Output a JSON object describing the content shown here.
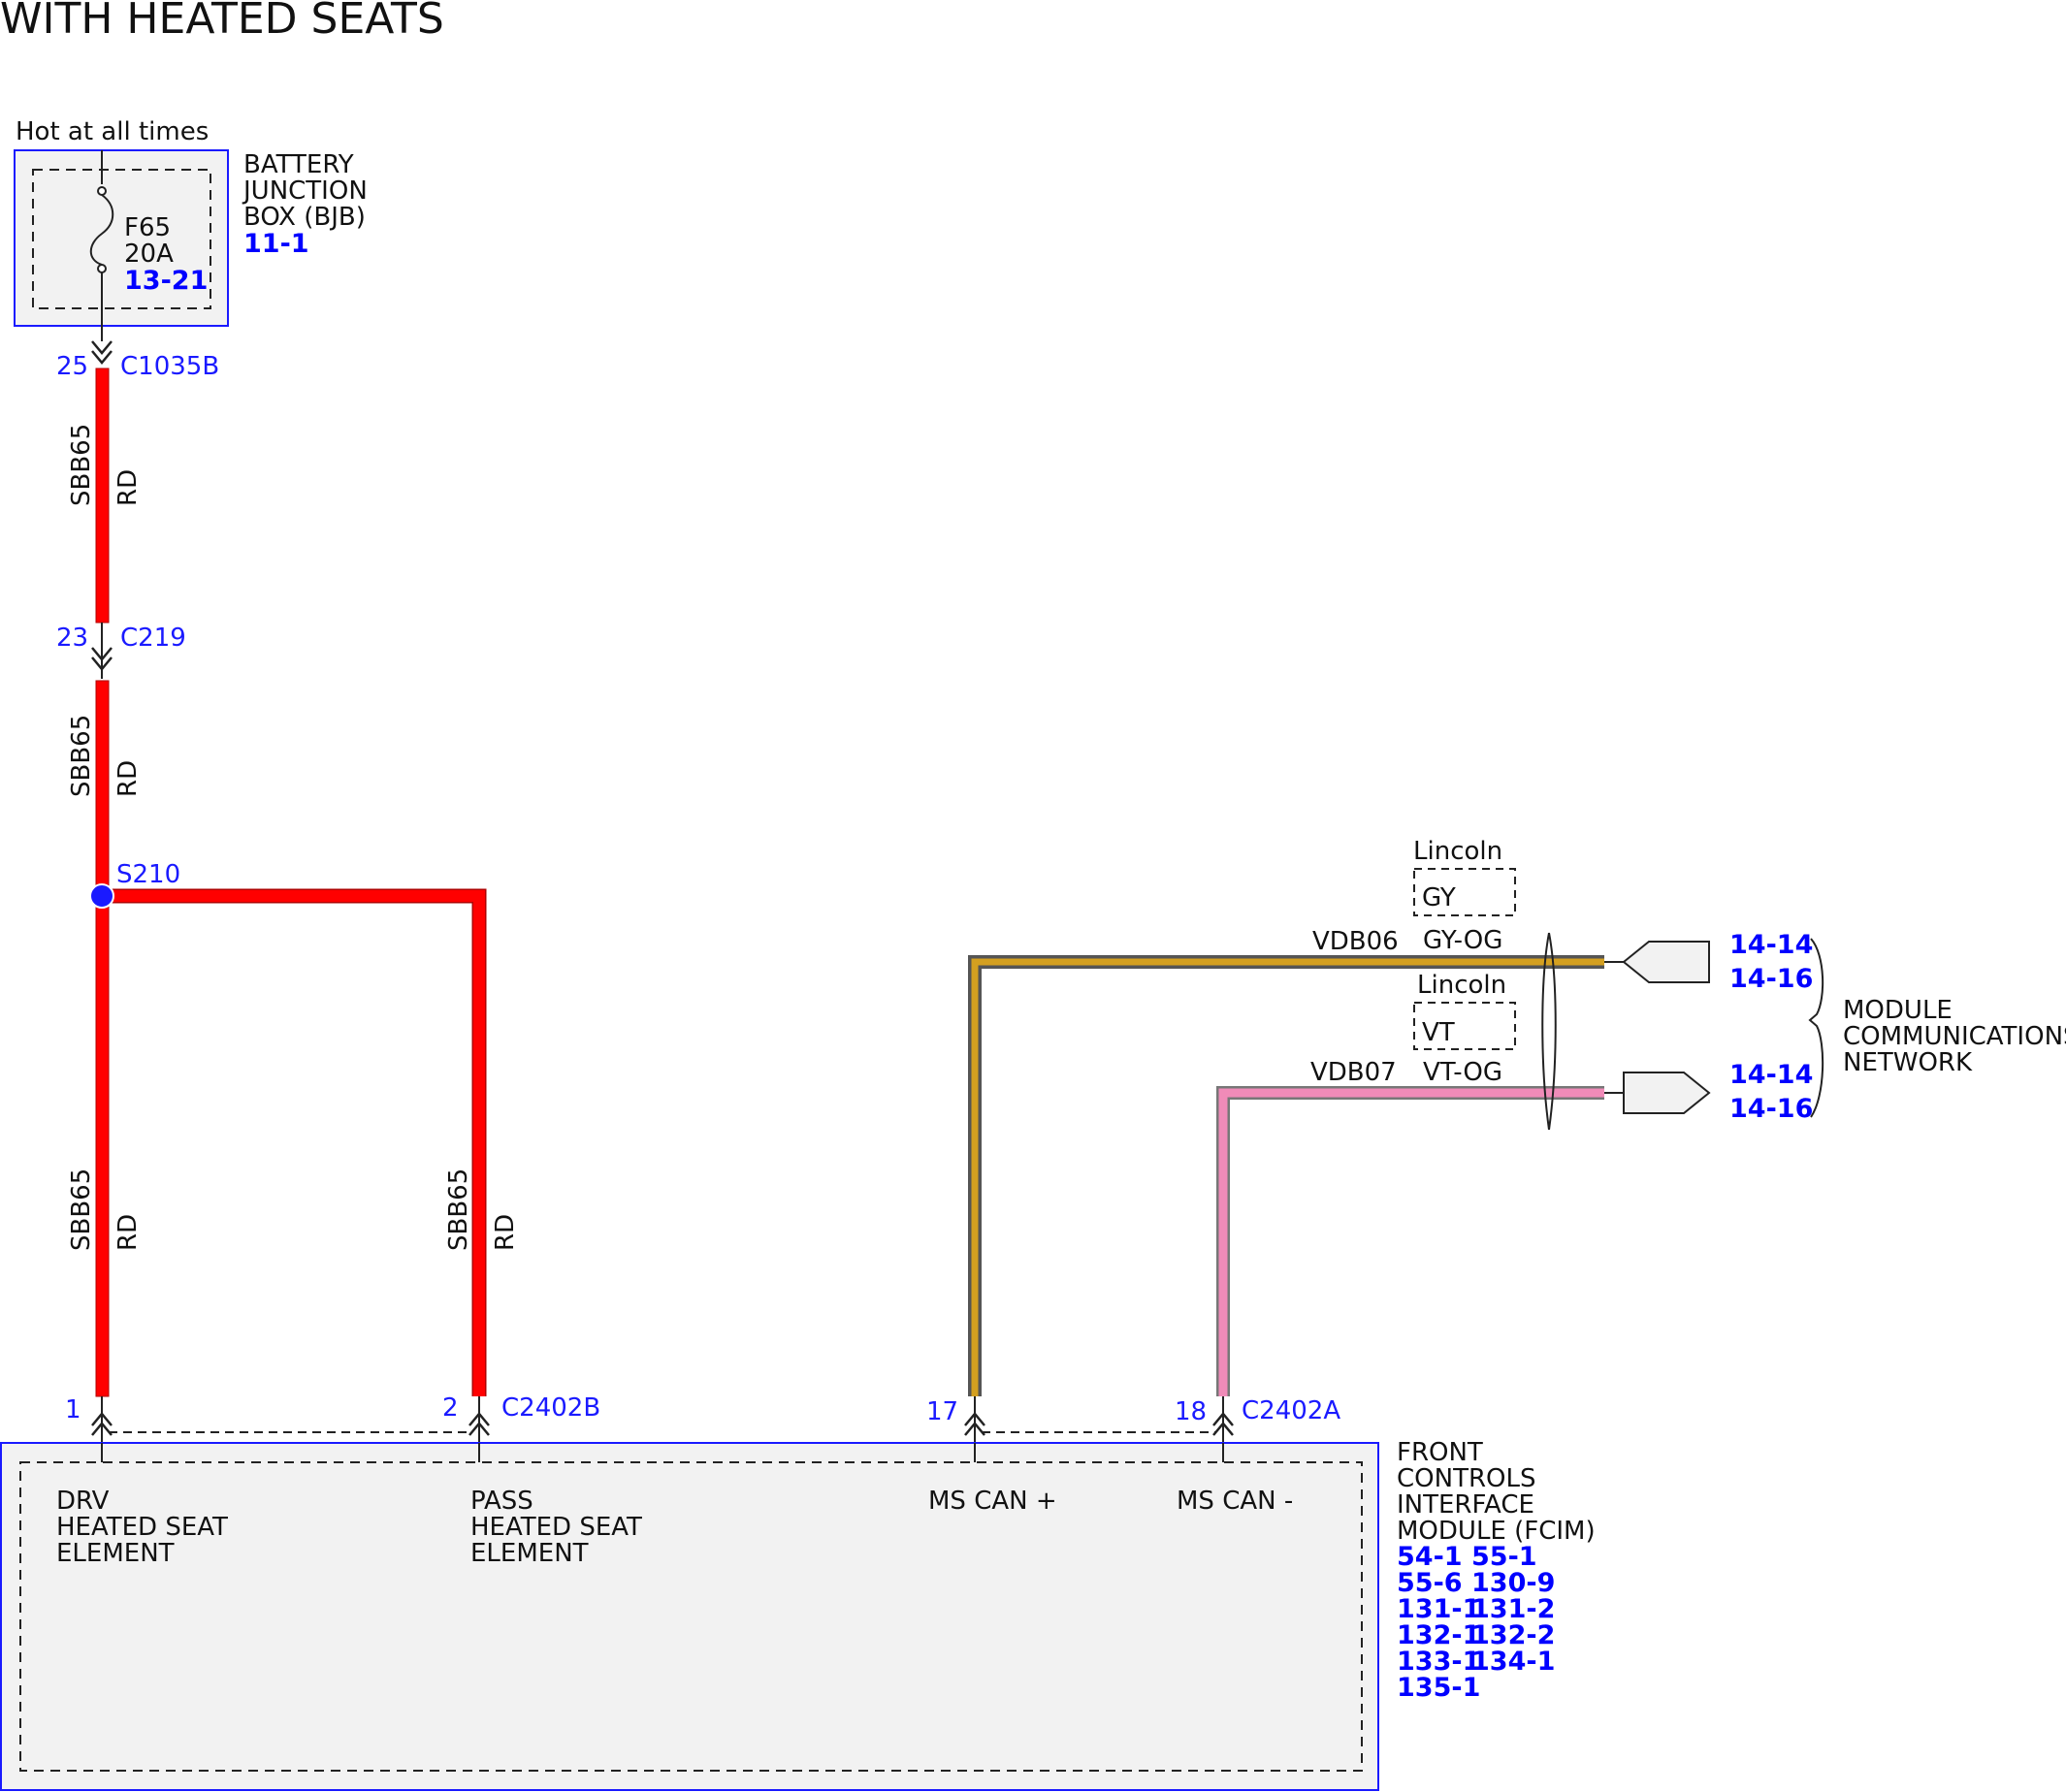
{
  "title": "WITH HEATED SEATS",
  "colors": {
    "wire_red": "#ff0000",
    "wire_gray": "#555555",
    "wire_orange": "#d4a020",
    "wire_pink": "#f08bb8",
    "reference_blue": "#0000ff",
    "outline_blue": "#1a1aff",
    "module_fill": "#f2f2f2"
  },
  "bjb": {
    "supply_label": "Hot at all times",
    "fuse_id": "F65",
    "fuse_rating": "20A",
    "fuse_ref": "13-21",
    "name_line1": "BATTERY",
    "name_line2": "JUNCTION",
    "name_line3": "BOX (BJB)",
    "ref": "11-1"
  },
  "connectors": {
    "c1035b": {
      "pin": "25",
      "name": "C1035B"
    },
    "c219": {
      "pin": "23",
      "name": "C219"
    },
    "c2402b": {
      "name": "C2402B"
    },
    "c2402a": {
      "name": "C2402A"
    }
  },
  "splice": {
    "name": "S210"
  },
  "wires": {
    "sbb65_seg1": {
      "circuit": "SBB65",
      "color": "RD"
    },
    "sbb65_seg2": {
      "circuit": "SBB65",
      "color": "RD"
    },
    "sbb65_drv": {
      "circuit": "SBB65",
      "color": "RD"
    },
    "sbb65_pass": {
      "circuit": "SBB65",
      "color": "RD"
    },
    "vdb06": {
      "circuit": "VDB06",
      "color": "GY-OG",
      "option_label": "Lincoln",
      "option_color": "GY",
      "refs": [
        "14-14",
        "14-16"
      ]
    },
    "vdb07": {
      "circuit": "VDB07",
      "color": "VT-OG",
      "option_label": "Lincoln",
      "option_color": "VT",
      "refs": [
        "14-14",
        "14-16"
      ]
    }
  },
  "network": {
    "line1": "MODULE",
    "line2": "COMMUNICATIONS",
    "line3": "NETWORK"
  },
  "module": {
    "name": [
      "FRONT",
      "CONTROLS",
      "INTERFACE",
      "MODULE (FCIM)"
    ],
    "refs": [
      "54-1",
      "55-1",
      "55-6",
      "130-9",
      "131-1",
      "131-2",
      "132-1",
      "132-2",
      "133-1",
      "134-1",
      "135-1"
    ],
    "pins": [
      {
        "pin": "1",
        "func": [
          "DRV",
          "HEATED SEAT",
          "ELEMENT"
        ]
      },
      {
        "pin": "2",
        "func": [
          "PASS",
          "HEATED SEAT",
          "ELEMENT"
        ]
      },
      {
        "pin": "17",
        "func": [
          "MS CAN +"
        ]
      },
      {
        "pin": "18",
        "func": [
          "MS CAN -"
        ]
      }
    ]
  }
}
